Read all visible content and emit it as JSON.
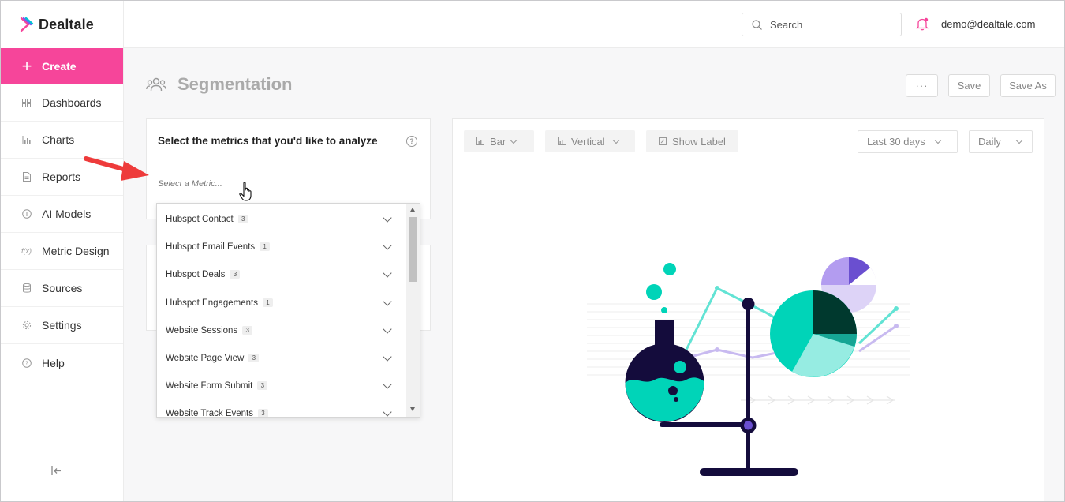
{
  "brand": {
    "name": "Dealtale"
  },
  "sidebar": {
    "create_label": "Create",
    "items": [
      {
        "label": "Dashboards",
        "icon": "dashboard-grid-icon"
      },
      {
        "label": "Charts",
        "icon": "bar-chart-icon"
      },
      {
        "label": "Reports",
        "icon": "document-icon"
      },
      {
        "label": "AI Models",
        "icon": "info-circle-icon"
      },
      {
        "label": "Metric Design",
        "icon": "function-icon"
      },
      {
        "label": "Sources",
        "icon": "database-icon"
      },
      {
        "label": "Settings",
        "icon": "gear-icon"
      },
      {
        "label": "Help",
        "icon": "help-circle-icon"
      }
    ]
  },
  "header": {
    "search_placeholder": "Search",
    "user_email": "demo@dealtale.com"
  },
  "page": {
    "title": "Segmentation",
    "more_label": "···",
    "save_label": "Save",
    "save_as_label": "Save As"
  },
  "metrics": {
    "title": "Select the metrics that you'd like to analyze",
    "select_placeholder": "Select a Metric...",
    "options": [
      {
        "label": "Hubspot Contact",
        "count": "3"
      },
      {
        "label": "Hubspot Email Events",
        "count": "1"
      },
      {
        "label": "Hubspot Deals",
        "count": "3"
      },
      {
        "label": "Hubspot Engagements",
        "count": "1"
      },
      {
        "label": "Website Sessions",
        "count": "3"
      },
      {
        "label": "Website Page View",
        "count": "3"
      },
      {
        "label": "Website Form Submit",
        "count": "3"
      },
      {
        "label": "Website Track Events",
        "count": "3"
      }
    ]
  },
  "chart_controls": {
    "type_label": "Bar",
    "orientation_label": "Vertical",
    "show_label": "Show Label",
    "range_label": "Last 30 days",
    "interval_label": "Daily"
  },
  "colors": {
    "accent_pink": "#f6459a",
    "teal": "#00d4b8",
    "navy": "#140c3c",
    "lavender": "#b9a6f0"
  }
}
